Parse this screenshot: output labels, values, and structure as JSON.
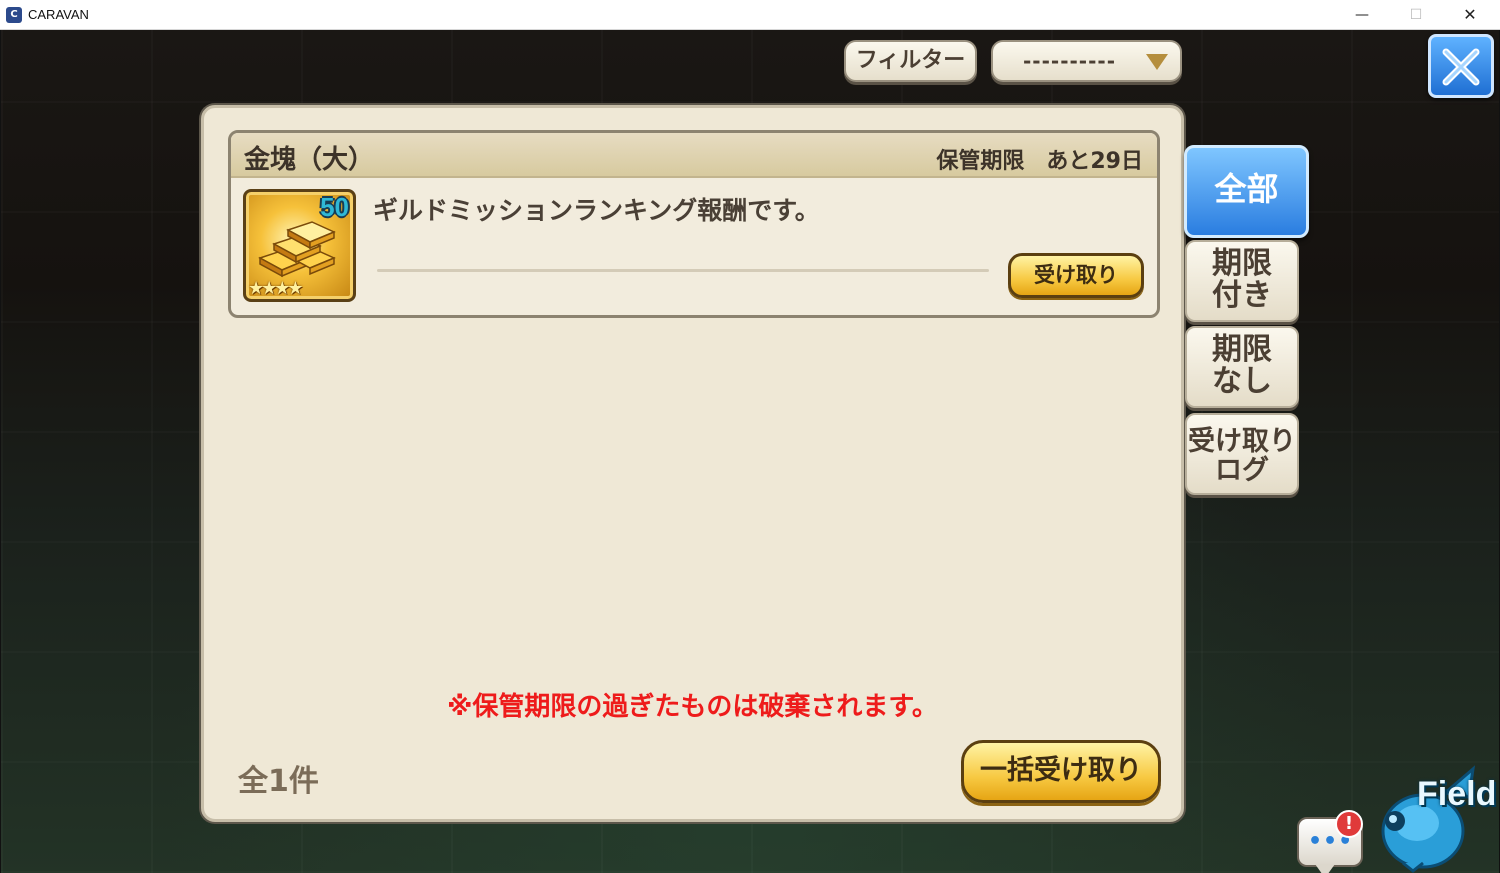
{
  "window": {
    "title": "CARAVAN",
    "minimize_label": "—",
    "maximize_label": "☐",
    "close_label": "✕"
  },
  "filter": {
    "button_label": "フィルター",
    "selected_value": "----------",
    "dropdown_icon": "chevron-down-icon"
  },
  "close_button": {
    "icon": "close-icon"
  },
  "mail_item": {
    "name": "金塊（大）",
    "expiry_label": "保管期限",
    "expiry_value": "あと29日",
    "quantity": "50",
    "rarity_stars": "★★★★",
    "description": "ギルドミッションランキング報酬です。",
    "receive_label": "受け取り",
    "icon": "gold-bars-icon"
  },
  "notice": "※保管期限の過ぎたものは破棄されます。",
  "total_count": "全1件",
  "bulk_receive_label": "一括受け取り",
  "tabs": {
    "all": "全部",
    "limited": [
      "期限",
      "付き"
    ],
    "unlimited": [
      "期限",
      "なし"
    ],
    "log": [
      "受け取り",
      "ログ"
    ]
  },
  "field_shortcut": {
    "label": "Field"
  },
  "chat": {
    "dots": "•••",
    "alert": "!"
  },
  "colors": {
    "accent_blue": "#2a7de0",
    "gold_button": "#f7c942",
    "warning_red": "#ee1b1b",
    "panel": "#efe8d6"
  }
}
